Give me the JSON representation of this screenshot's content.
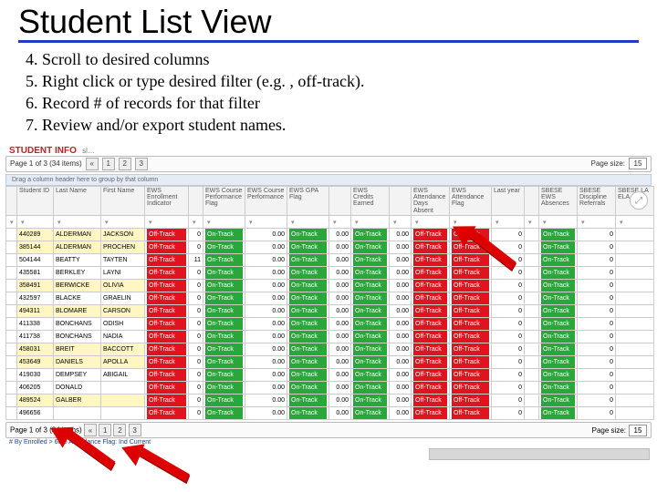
{
  "title": "Student List View",
  "instructions": [
    "4. Scroll to desired columns",
    "5. Right click or type desired filter (e.g. , off-track).",
    "6. Record # of records for that filter",
    "7. Review and/or export student names."
  ],
  "panel": {
    "section_title": "STUDENT INFO",
    "sub": "sl…",
    "pager_text": "Page 1 of 3 (34 items)",
    "page_current": "1",
    "page_next": "2",
    "page_last": "3",
    "page_size_label": "Page size:",
    "page_size_value": "15",
    "group_hint": "Drag a column header here to group by that column",
    "chart_icon": "chart-icon"
  },
  "columns": [
    "",
    "Student ID",
    "Last Name",
    "First Name",
    "EWS Enrollment Indicator",
    "",
    "EWS Course Performance Flag",
    "EWS Course Performance",
    "EWS GPA Flag",
    "",
    "EWS Credits Earned",
    "",
    "EWS Attendance Days Absent",
    "EWS Attendance Flag",
    "Last year",
    "",
    "SBESE EWS Absences",
    "SBESE Discipline Referrals",
    "SBESE LA ELA"
  ],
  "rows": [
    {
      "id": "440289",
      "hl": true,
      "last": "ALDERMAN",
      "first": "JACKSON",
      "enroll": [
        "Off-Track",
        "off"
      ],
      "n1": "0",
      "cp": [
        "On-Track",
        "on"
      ],
      "gpaF": "0.00",
      "gpa": [
        "On-Track",
        "on"
      ],
      "credF": "0.00",
      "cred": [
        "On-Track",
        "on"
      ],
      "attN": "0.00",
      "att": [
        "Off-Track",
        "off"
      ],
      "ly": "0",
      "a": [
        "On-Track",
        "on"
      ],
      "b": "0"
    },
    {
      "id": "385144",
      "hl": true,
      "last": "ALDERMAN",
      "first": "PROCHEN",
      "enroll": [
        "Off-Track",
        "off"
      ],
      "n1": "0",
      "cp": [
        "On-Track",
        "on"
      ],
      "gpaF": "0.00",
      "gpa": [
        "On-Track",
        "on"
      ],
      "credF": "0.00",
      "cred": [
        "On-Track",
        "on"
      ],
      "attN": "0.00",
      "att": [
        "Off-Track",
        "off"
      ],
      "ly": "0",
      "a": [
        "On-Track",
        "on"
      ],
      "b": "0"
    },
    {
      "id": "504144",
      "hl": false,
      "last": "BEATTY",
      "first": "TAYTEN",
      "enroll": [
        "Off-Track",
        "off"
      ],
      "n1": "11",
      "cp": [
        "On-Track",
        "on"
      ],
      "gpaF": "0.00",
      "gpa": [
        "On-Track",
        "on"
      ],
      "credF": "0.00",
      "cred": [
        "On-Track",
        "on"
      ],
      "attN": "0.00",
      "att": [
        "Off-Track",
        "off"
      ],
      "ly": "0",
      "a": [
        "On-Track",
        "on"
      ],
      "b": "0"
    },
    {
      "id": "435581",
      "hl": false,
      "last": "BERKLEY",
      "first": "LAYNI",
      "enroll": [
        "Off-Track",
        "off"
      ],
      "n1": "0",
      "cp": [
        "On-Track",
        "on"
      ],
      "gpaF": "0.00",
      "gpa": [
        "On-Track",
        "on"
      ],
      "credF": "0.00",
      "cred": [
        "On-Track",
        "on"
      ],
      "attN": "0.00",
      "att": [
        "Off-Track",
        "off"
      ],
      "ly": "0",
      "a": [
        "On-Track",
        "on"
      ],
      "b": "0"
    },
    {
      "id": "358491",
      "hl": true,
      "last": "BERWICKE",
      "first": "OLIVIA",
      "enroll": [
        "Off-Track",
        "off"
      ],
      "n1": "0",
      "cp": [
        "On-Track",
        "on"
      ],
      "gpaF": "0.00",
      "gpa": [
        "On-Track",
        "on"
      ],
      "credF": "0.00",
      "cred": [
        "On-Track",
        "on"
      ],
      "attN": "0.00",
      "att": [
        "Off-Track",
        "off"
      ],
      "ly": "0",
      "a": [
        "On-Track",
        "on"
      ],
      "b": "0"
    },
    {
      "id": "432597",
      "hl": false,
      "last": "BLACKE",
      "first": "GRAELIN",
      "enroll": [
        "Off-Track",
        "off"
      ],
      "n1": "0",
      "cp": [
        "On-Track",
        "on"
      ],
      "gpaF": "0.00",
      "gpa": [
        "On-Track",
        "on"
      ],
      "credF": "0.00",
      "cred": [
        "On-Track",
        "on"
      ],
      "attN": "0.00",
      "att": [
        "Off-Track",
        "off"
      ],
      "ly": "0",
      "a": [
        "On-Track",
        "on"
      ],
      "b": "0"
    },
    {
      "id": "494311",
      "hl": true,
      "last": "BLOMARE",
      "first": "CARSON",
      "enroll": [
        "Off-Track",
        "off"
      ],
      "n1": "0",
      "cp": [
        "On-Track",
        "on"
      ],
      "gpaF": "0.00",
      "gpa": [
        "On-Track",
        "on"
      ],
      "credF": "0.00",
      "cred": [
        "On-Track",
        "on"
      ],
      "attN": "0.00",
      "att": [
        "Off-Track",
        "off"
      ],
      "ly": "0",
      "a": [
        "On-Track",
        "on"
      ],
      "b": "0"
    },
    {
      "id": "411338",
      "hl": false,
      "last": "BONCHANS",
      "first": "ODISH",
      "enroll": [
        "Off-Track",
        "off"
      ],
      "n1": "0",
      "cp": [
        "On-Track",
        "on"
      ],
      "gpaF": "0.00",
      "gpa": [
        "On-Track",
        "on"
      ],
      "credF": "0.00",
      "cred": [
        "On-Track",
        "on"
      ],
      "attN": "0.00",
      "att": [
        "Off-Track",
        "off"
      ],
      "ly": "0",
      "a": [
        "On-Track",
        "on"
      ],
      "b": "0"
    },
    {
      "id": "411738",
      "hl": false,
      "last": "BONCHANS",
      "first": "NADIA",
      "enroll": [
        "Off-Track",
        "off"
      ],
      "n1": "0",
      "cp": [
        "On-Track",
        "on"
      ],
      "gpaF": "0.00",
      "gpa": [
        "On-Track",
        "on"
      ],
      "credF": "0.00",
      "cred": [
        "On-Track",
        "on"
      ],
      "attN": "0.00",
      "att": [
        "Off-Track",
        "off"
      ],
      "ly": "0",
      "a": [
        "On-Track",
        "on"
      ],
      "b": "0"
    },
    {
      "id": "458031",
      "hl": true,
      "last": "BREIT",
      "first": "BACCOTT",
      "enroll": [
        "Off-Track",
        "off"
      ],
      "n1": "0",
      "cp": [
        "On-Track",
        "on"
      ],
      "gpaF": "0.00",
      "gpa": [
        "On-Track",
        "on"
      ],
      "credF": "0.00",
      "cred": [
        "On-Track",
        "on"
      ],
      "attN": "0.00",
      "att": [
        "Off-Track",
        "off"
      ],
      "ly": "0",
      "a": [
        "On-Track",
        "on"
      ],
      "b": "0"
    },
    {
      "id": "453649",
      "hl": true,
      "last": "DANIELS",
      "first": "APOLLA",
      "enroll": [
        "Off-Track",
        "off"
      ],
      "n1": "0",
      "cp": [
        "On-Track",
        "on"
      ],
      "gpaF": "0.00",
      "gpa": [
        "On-Track",
        "on"
      ],
      "credF": "0.00",
      "cred": [
        "On-Track",
        "on"
      ],
      "attN": "0.00",
      "att": [
        "Off-Track",
        "off"
      ],
      "ly": "0",
      "a": [
        "On-Track",
        "on"
      ],
      "b": "0"
    },
    {
      "id": "419030",
      "hl": false,
      "last": "DEMPSEY",
      "first": "ABIGAIL",
      "enroll": [
        "Off-Track",
        "off"
      ],
      "n1": "0",
      "cp": [
        "On-Track",
        "on"
      ],
      "gpaF": "0.00",
      "gpa": [
        "On-Track",
        "on"
      ],
      "credF": "0.00",
      "cred": [
        "On-Track",
        "on"
      ],
      "attN": "0.00",
      "att": [
        "Off-Track",
        "off"
      ],
      "ly": "0",
      "a": [
        "On-Track",
        "on"
      ],
      "b": "0"
    },
    {
      "id": "406205",
      "hl": false,
      "last": "DONALD",
      "first": "",
      "enroll": [
        "Off-Track",
        "off"
      ],
      "n1": "0",
      "cp": [
        "On-Track",
        "on"
      ],
      "gpaF": "0.00",
      "gpa": [
        "On-Track",
        "on"
      ],
      "credF": "0.00",
      "cred": [
        "On-Track",
        "on"
      ],
      "attN": "0.00",
      "att": [
        "Off-Track",
        "off"
      ],
      "ly": "0",
      "a": [
        "On-Track",
        "on"
      ],
      "b": "0"
    },
    {
      "id": "489524",
      "hl": true,
      "last": "GALBER",
      "first": "",
      "enroll": [
        "Off-Track",
        "off"
      ],
      "n1": "0",
      "cp": [
        "On-Track",
        "on"
      ],
      "gpaF": "0.00",
      "gpa": [
        "On-Track",
        "on"
      ],
      "credF": "0.00",
      "cred": [
        "On-Track",
        "on"
      ],
      "attN": "0.00",
      "att": [
        "Off-Track",
        "off"
      ],
      "ly": "0",
      "a": [
        "On-Track",
        "on"
      ],
      "b": "0"
    },
    {
      "id": "496656",
      "hl": false,
      "last": "",
      "first": "",
      "enroll": [
        "Off-Track",
        "off"
      ],
      "n1": "0",
      "cp": [
        "On-Track",
        "on"
      ],
      "gpaF": "0.00",
      "gpa": [
        "On-Track",
        "on"
      ],
      "credF": "0.00",
      "cred": [
        "On-Track",
        "on"
      ],
      "attN": "0.00",
      "att": [
        "Off-Track",
        "off"
      ],
      "ly": "0",
      "a": [
        "On-Track",
        "on"
      ],
      "b": "0"
    }
  ],
  "footer": {
    "pager_text": "Page 1 of 3 (34 items)",
    "page_size_value": "15",
    "legend": "# By Enrolled > 60% Attendance Flag: Ind Current"
  }
}
